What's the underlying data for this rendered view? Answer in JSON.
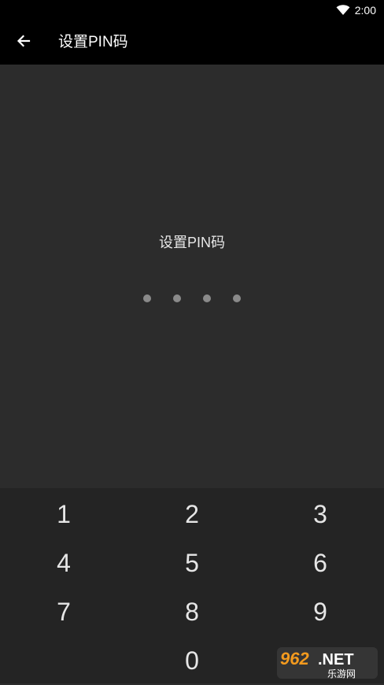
{
  "status_bar": {
    "time": "2:00",
    "icon": "wifi-icon"
  },
  "app_bar": {
    "title": "设置PIN码",
    "back_icon": "arrow-left-icon"
  },
  "main": {
    "prompt": "设置PIN码",
    "pin_length": 4
  },
  "keypad": {
    "keys": [
      "1",
      "2",
      "3",
      "4",
      "5",
      "6",
      "7",
      "8",
      "9",
      "0"
    ]
  },
  "watermark": {
    "brand": "962.NET",
    "subtitle": "乐游网"
  }
}
